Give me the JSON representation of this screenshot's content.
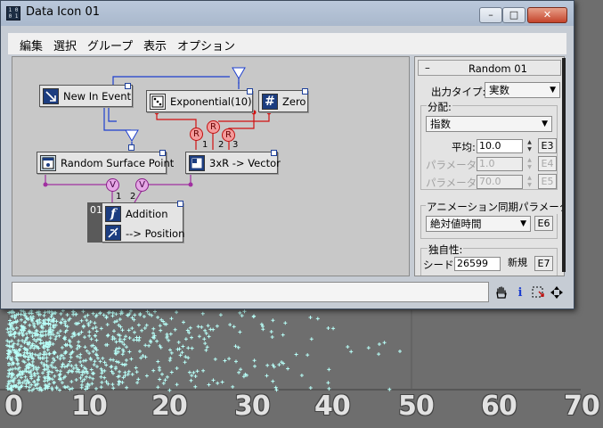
{
  "window": {
    "title": "Data Icon 01",
    "app_icon_text": "1 0\n0 1",
    "controls": {
      "minimize": "–",
      "maximize": "□",
      "close": "✕"
    }
  },
  "menu": [
    "編集",
    "選択",
    "グループ",
    "表示",
    "オプション"
  ],
  "graph": {
    "nodes": {
      "new_in_event": "New In Event",
      "exponential": "Exponential(10)",
      "zero": "Zero",
      "random_surface_point": "Random Surface Point",
      "vector": "3xR -> Vector",
      "addition": "Addition",
      "position": "--> Position",
      "node_index": "01"
    },
    "ports": {
      "r": "R",
      "v": "V",
      "one": "1",
      "two": "2",
      "three": "3"
    },
    "icons": {
      "zero": "#",
      "addition": "f"
    }
  },
  "panel": {
    "title": "Random 01",
    "collapse": "–",
    "output_type_label": "出力タイプ:",
    "output_type_value": "実数",
    "distribution_group": "分配:",
    "distribution_value": "指数",
    "mean_label": "平均:",
    "mean_value": "10.0",
    "mean_btn": "E3",
    "param2_label": "パラメータ 2:",
    "param2_value": "1.0",
    "param2_btn": "E4",
    "param3_label": "パラメータ 3:",
    "param3_value": "70.0",
    "param3_btn": "E5",
    "anim_group": "アニメーション同期パラメータ:",
    "anim_value": "絶対値時間",
    "anim_btn": "E6",
    "uniqueness_group": "独自性:",
    "seed_label": "シード:",
    "seed_value": "26599",
    "new_btn": "新規",
    "seed_btn": "E7"
  },
  "toolbar_icons": [
    "hand-pan-icon",
    "info-icon",
    "select-region-icon",
    "move-icon"
  ],
  "axis_labels": [
    "0",
    "10",
    "20",
    "30",
    "40",
    "50",
    "60",
    "70"
  ],
  "colors": {
    "title_bar": "#b4c3d7",
    "particles": "#b8fff8",
    "wire_blue": "#1d3fcf",
    "wire_red": "#d21010",
    "wire_purple": "#a030a0",
    "viewport_bg": "#6e6e6e"
  }
}
